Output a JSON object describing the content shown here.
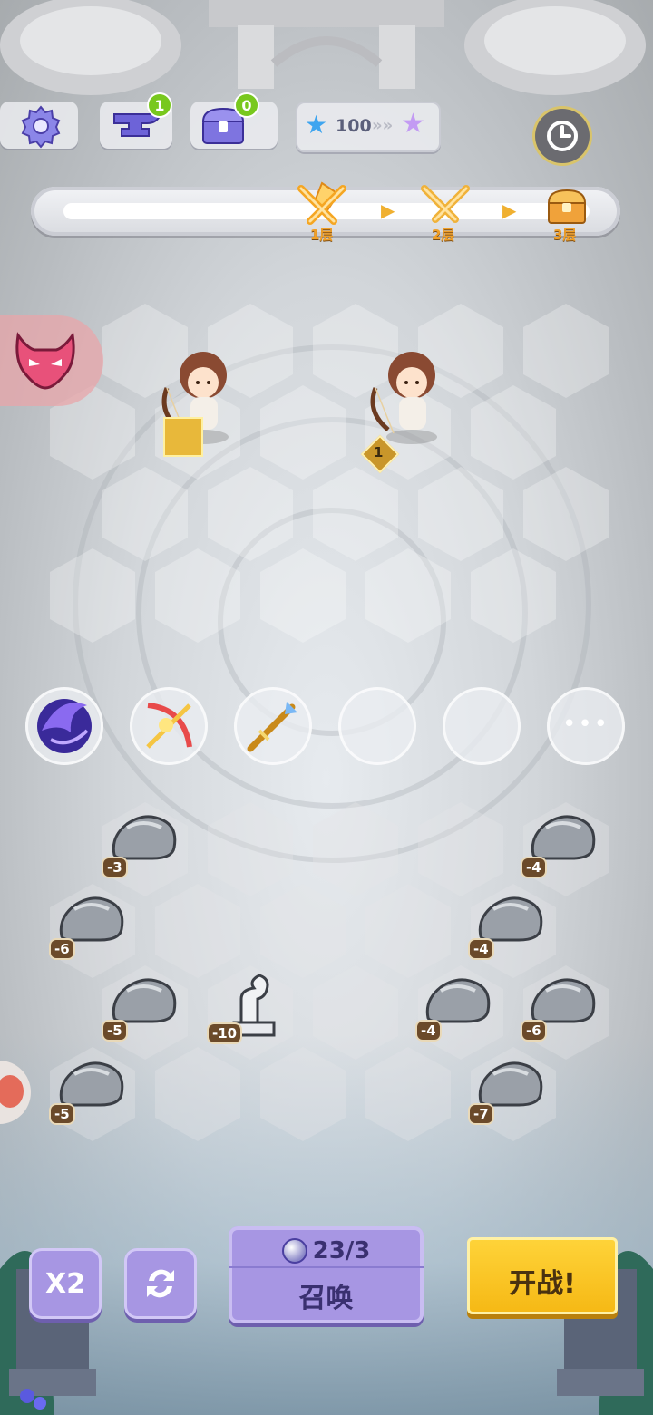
{
  "hud": {
    "anvil_count": "1",
    "chest_count": "0",
    "star_currency": "100"
  },
  "progress": {
    "stages": [
      {
        "label": "1层",
        "icon": "crossed-swords-icon"
      },
      {
        "label": "2层",
        "icon": "crossed-swords-icon"
      },
      {
        "label": "3层",
        "icon": "treasure-chest-icon"
      }
    ]
  },
  "units": [
    {
      "name": "archer",
      "level": ""
    },
    {
      "name": "archer",
      "level": "1"
    }
  ],
  "obstacles": [
    {
      "value": "-3"
    },
    {
      "value": "-4"
    },
    {
      "value": "-6"
    },
    {
      "value": "-4"
    },
    {
      "value": "-5"
    },
    {
      "value": "-10"
    },
    {
      "value": "-4"
    },
    {
      "value": "-6"
    },
    {
      "value": "-5"
    },
    {
      "value": "-7"
    }
  ],
  "skills": {
    "items": [
      "dark-wing-skill-icon",
      "flaming-bow-skill-icon",
      "golden-spear-skill-icon"
    ],
    "more_label": "•••"
  },
  "controls": {
    "speed_label": "X2",
    "summon_cost": "23/3",
    "summon_label": "召唤",
    "fight_label": "开战!"
  },
  "colors": {
    "summon_bg": "#a796e3",
    "fight_bg": "#f5b814",
    "speed_bg": "#a796e3",
    "stage_label": "#f0a02a"
  }
}
